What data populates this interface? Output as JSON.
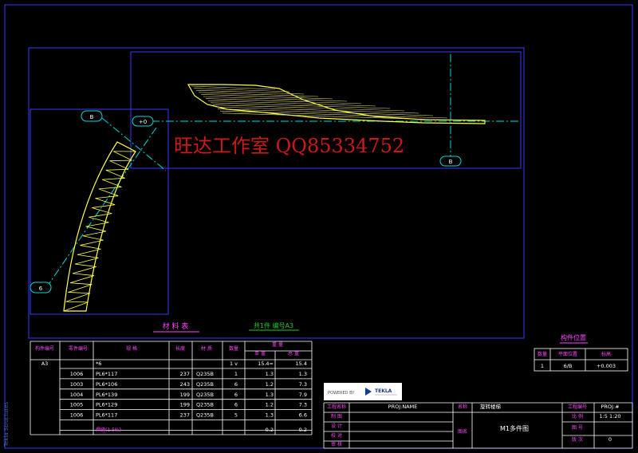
{
  "watermark": "旺达工作室 QQ85334752",
  "side_label": "Tekla Structures",
  "grid_labels": {
    "b_top": "B",
    "b_right": "B",
    "six": "6",
    "zero": "+0"
  },
  "materials": {
    "title": "材 料 表",
    "summary": "共1件 编号A3",
    "headers": {
      "member_no": "构件编号",
      "part_no": "零件编号",
      "spec": "规   格",
      "length": "长度",
      "material": "材 质",
      "count": "数量",
      "weight": "重  量",
      "unit": "单 重",
      "total": "总 重"
    },
    "member_mark": "A3",
    "member_row": {
      "spec": "*6",
      "count": "1 v",
      "unit": "15.4=",
      "total": "15.4"
    },
    "rows": [
      {
        "part": "1006",
        "spec": "PL6*117",
        "length": "237",
        "material": "Q235B",
        "count": "1",
        "unit": "1.3",
        "total": "1.3"
      },
      {
        "part": "1003",
        "spec": "PL6*106",
        "length": "243",
        "material": "Q235B",
        "count": "6",
        "unit": "1.2",
        "total": "7.3"
      },
      {
        "part": "1004",
        "spec": "PL6*139",
        "length": "199",
        "material": "Q235B",
        "count": "6",
        "unit": "1.3",
        "total": "7.9"
      },
      {
        "part": "1005",
        "spec": "PL6*129",
        "length": "199",
        "material": "Q235B",
        "count": "6",
        "unit": "1.2",
        "total": "7.3"
      },
      {
        "part": "1006",
        "spec": "PL6*117",
        "length": "237",
        "material": "Q235B",
        "count": "5",
        "unit": "1.3",
        "total": "6.6"
      }
    ],
    "weld": {
      "label": "焊缝(1.5%)",
      "unit": "0.2",
      "total": "0.2"
    }
  },
  "position": {
    "title": "构件位置",
    "headers": {
      "count": "数量",
      "plane": "平面位置",
      "elev": "标高"
    },
    "row": {
      "count": "1",
      "plane": "6/B",
      "elev": "+0.003"
    }
  },
  "title_block": {
    "powered": "POWERED BY",
    "logo": "TEKLA",
    "project_label": "工程名称",
    "project": "PROJ:NAME",
    "drawn": "制  图",
    "designed": "设  计",
    "checked": "校  对",
    "approved": "审  核",
    "name_label": "名称",
    "name": "旋转楼梯",
    "drawing_label": "图名",
    "drawing": "M1多件图",
    "proj_no_label": "工程编号",
    "proj_no": "PROJ:#",
    "scale_label": "比  例",
    "scale": "1:5    1:20",
    "sheet_label": "图  号",
    "sheet": "",
    "rev_label": "版  次",
    "rev": "0"
  }
}
